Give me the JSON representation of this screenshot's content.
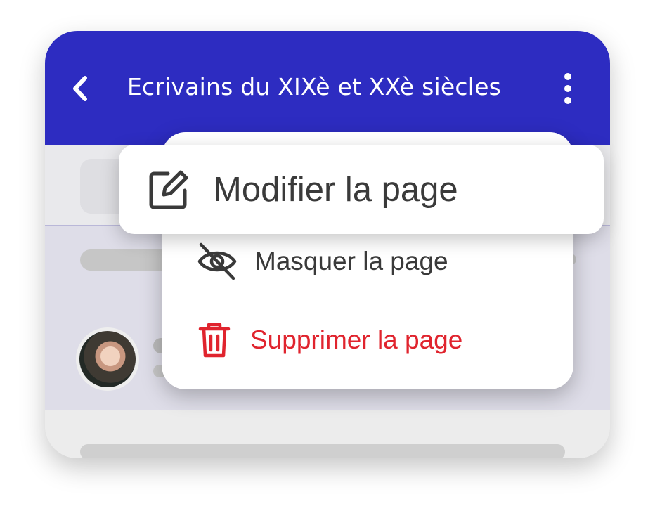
{
  "app": {
    "title": "Ecrivains du XIXè et XXè siècles",
    "colors": {
      "appbar": "#2d2cc1",
      "danger": "#e0242e",
      "text": "#3a3a3a"
    },
    "icons": {
      "back": "chevron-left-icon",
      "more": "more-vertical-icon"
    }
  },
  "menu": {
    "items": [
      {
        "label": "Modifier la page",
        "icon": "edit-icon",
        "highlighted": true
      },
      {
        "label": "Masquer la page",
        "icon": "eye-off-icon"
      },
      {
        "label": "Supprimer la page",
        "icon": "trash-icon",
        "danger": true
      }
    ]
  }
}
